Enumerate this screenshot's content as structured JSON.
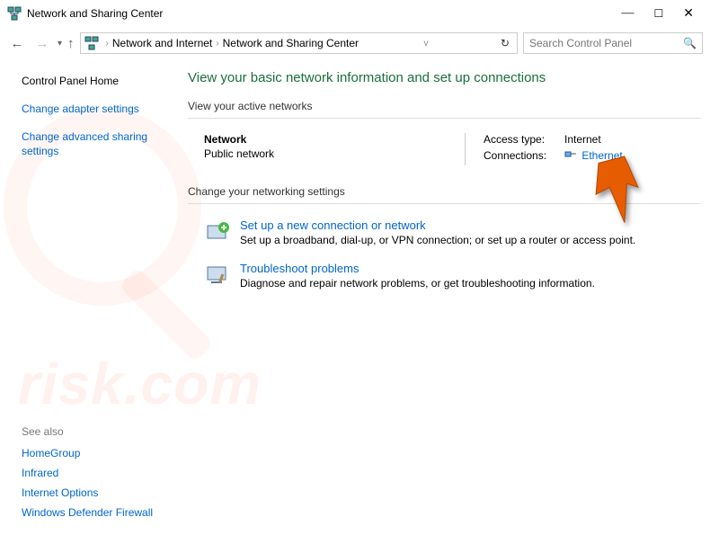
{
  "titlebar": {
    "title": "Network and Sharing Center"
  },
  "breadcrumb": {
    "items": [
      "Network and Internet",
      "Network and Sharing Center"
    ]
  },
  "search": {
    "placeholder": "Search Control Panel"
  },
  "sidebar": {
    "home": "Control Panel Home",
    "link1": "Change adapter settings",
    "link2": "Change advanced sharing settings",
    "seealso_head": "See also",
    "sa1": "HomeGroup",
    "sa2": "Infrared",
    "sa3": "Internet Options",
    "sa4": "Windows Defender Firewall"
  },
  "content": {
    "page_title": "View your basic network information and set up connections",
    "active_header": "View your active networks",
    "network_name": "Network",
    "network_type": "Public network",
    "access_label": "Access type:",
    "access_value": "Internet",
    "conn_label": "Connections:",
    "conn_value": "Ethernet",
    "change_header": "Change your networking settings",
    "action1_title": "Set up a new connection or network",
    "action1_desc": "Set up a broadband, dial-up, or VPN connection; or set up a router or access point.",
    "action2_title": "Troubleshoot problems",
    "action2_desc": "Diagnose and repair network problems, or get troubleshooting information."
  }
}
